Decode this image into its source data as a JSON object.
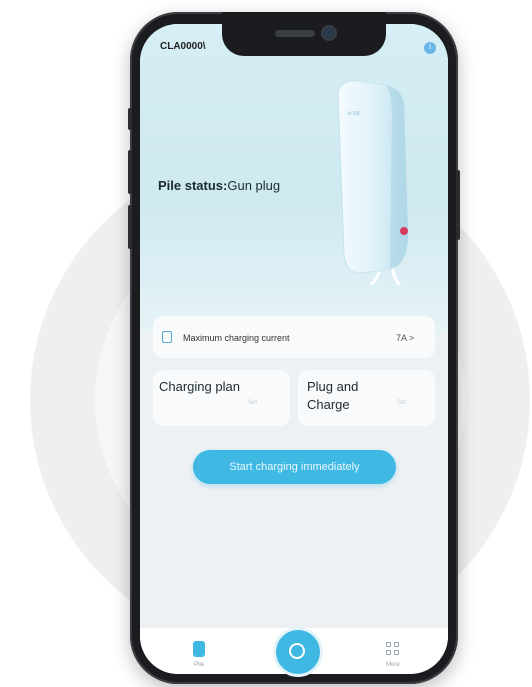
{
  "app": {
    "device_id": "CLA0000\\",
    "corner_badge": "i"
  },
  "hero": {
    "status_label": "Pile status:",
    "status_value": "Gun plug",
    "charger_badge": "e tot"
  },
  "max_current": {
    "label": "Maximum charging current",
    "value": "7A >",
    "icon": "document-icon"
  },
  "cards": [
    {
      "title": "Charging plan",
      "hint": "Set"
    },
    {
      "title": "Plug and Charge",
      "hint": "Set"
    }
  ],
  "start_button": {
    "label": "Start charging immediately"
  },
  "bottom_nav": {
    "items": [
      {
        "label": "Pile",
        "icon": "charger-icon"
      },
      {
        "label": "",
        "icon": "charge-center-icon"
      },
      {
        "label": "More",
        "icon": "grid-icon"
      }
    ]
  },
  "colors": {
    "accent": "#3fb8e4",
    "hero_bg": "#d6eef5",
    "frame": "#1a1c1f"
  }
}
